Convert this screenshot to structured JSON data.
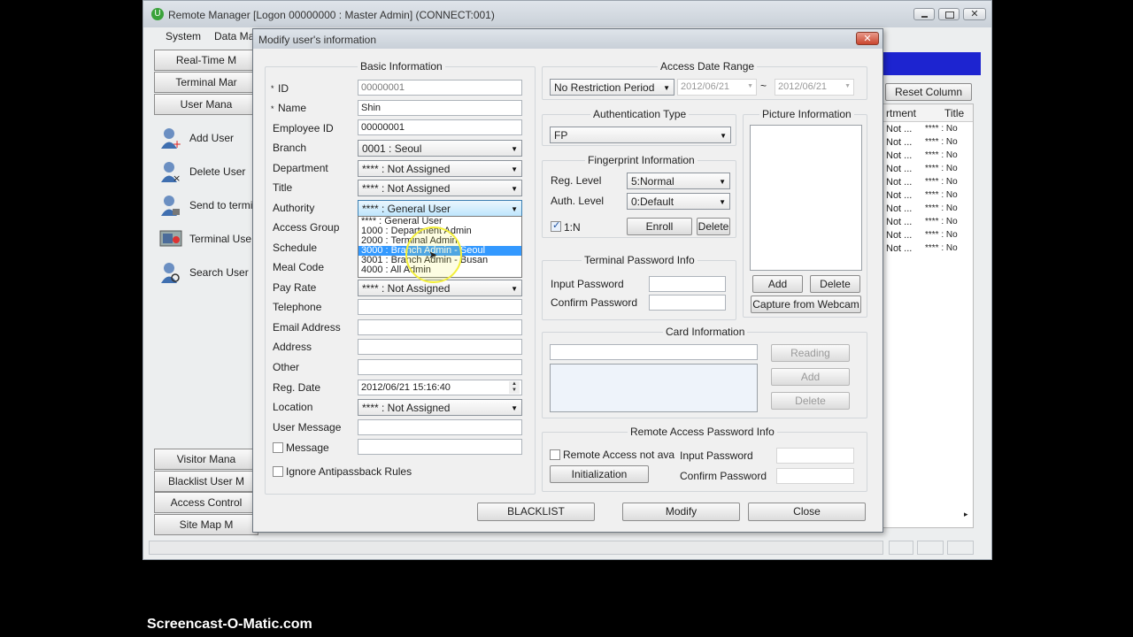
{
  "app": {
    "title": "Remote Manager [Logon 00000000 : Master Admin] (CONNECT:001)",
    "menu": [
      "System",
      "Data Ma"
    ],
    "nav_top": [
      "Real-Time M",
      "Terminal Mar",
      "User Mana"
    ],
    "user_actions": [
      "Add User",
      "Delete User",
      "Send to termi",
      "Terminal Use",
      "Search User I"
    ],
    "nav_bottom": [
      "Visitor Mana",
      "Blacklist User M",
      "Access Control",
      "Site Map M"
    ],
    "right_panel": {
      "reset_column": "Reset Column",
      "col_a": "rtment",
      "col_b": "Title",
      "rows": [
        [
          "Not ...",
          "**** : No"
        ],
        [
          "Not ...",
          "**** : No"
        ],
        [
          "Not ...",
          "**** : No"
        ],
        [
          "Not ...",
          "**** : No"
        ],
        [
          "Not ...",
          "**** : No"
        ],
        [
          "Not ...",
          "**** : No"
        ],
        [
          "Not ...",
          "**** : No"
        ],
        [
          "Not ...",
          "**** : No"
        ],
        [
          "Not ...",
          "**** : No"
        ],
        [
          "Not ...",
          "**** : No"
        ]
      ]
    }
  },
  "dialog": {
    "title": "Modify user's information",
    "basic": {
      "title": "Basic Information",
      "labels": {
        "id": "ID",
        "name": "Name",
        "employee_id": "Employee ID",
        "branch": "Branch",
        "department": "Department",
        "title": "Title",
        "authority": "Authority",
        "access_group": "Access Group",
        "schedule": "Schedule",
        "meal_code": "Meal Code",
        "pay_rate": "Pay Rate",
        "telephone": "Telephone",
        "email": "Email Address",
        "address": "Address",
        "other": "Other",
        "reg_date": "Reg. Date",
        "location": "Location",
        "user_message": "User Message",
        "message": "Message",
        "ignore_apb": "Ignore Antipassback Rules"
      },
      "values": {
        "id": "00000001",
        "name": "Shin",
        "employee_id": "00000001",
        "branch": "0001 : Seoul",
        "department": "**** : Not Assigned",
        "title": "**** : Not Assigned",
        "authority": "**** : General User",
        "pay_rate": "**** : Not Assigned",
        "reg_date": "2012/06/21 15:16:40",
        "location": "**** : Not Assigned"
      },
      "authority_options": [
        "**** : General User",
        "1000 : Department Admin",
        "2000 : Terminal Admin",
        "3000 : Branch Admin - Seoul",
        "3001 : Branch Admin - Busan",
        "4000 : All Admin"
      ]
    },
    "access_date": {
      "title": "Access Date Range",
      "mode": "No Restriction Period",
      "from": "2012/06/21",
      "tilde": "~",
      "to": "2012/06/21"
    },
    "auth_type": {
      "title": "Authentication Type",
      "value": "FP"
    },
    "fingerprint": {
      "title": "Fingerprint Information",
      "reg_level_label": "Reg. Level",
      "reg_level": "5:Normal",
      "auth_level_label": "Auth. Level",
      "auth_level": "0:Default",
      "one_n": "1:N",
      "enroll": "Enroll",
      "delete": "Delete"
    },
    "picture": {
      "title": "Picture Information",
      "add": "Add",
      "delete": "Delete",
      "capture": "Capture from Webcam"
    },
    "terminal_password": {
      "title": "Terminal Password Info",
      "input": "Input Password",
      "confirm": "Confirm Password"
    },
    "card": {
      "title": "Card Information",
      "reading": "Reading",
      "add": "Add",
      "delete": "Delete"
    },
    "remote_password": {
      "title": "Remote Access Password Info",
      "not_available": "Remote Access not ava",
      "initialization": "Initialization",
      "input": "Input Password",
      "confirm": "Confirm Password"
    },
    "footer": {
      "blacklist": "BLACKLIST",
      "modify": "Modify",
      "close": "Close"
    }
  },
  "watermark": "Screencast-O-Matic.com",
  "colors": {
    "title_bar": "#d6dce3",
    "highlight": "#3399ff",
    "header_blue": "#1d24d0",
    "cursor_ring": "#f3ef3a"
  }
}
